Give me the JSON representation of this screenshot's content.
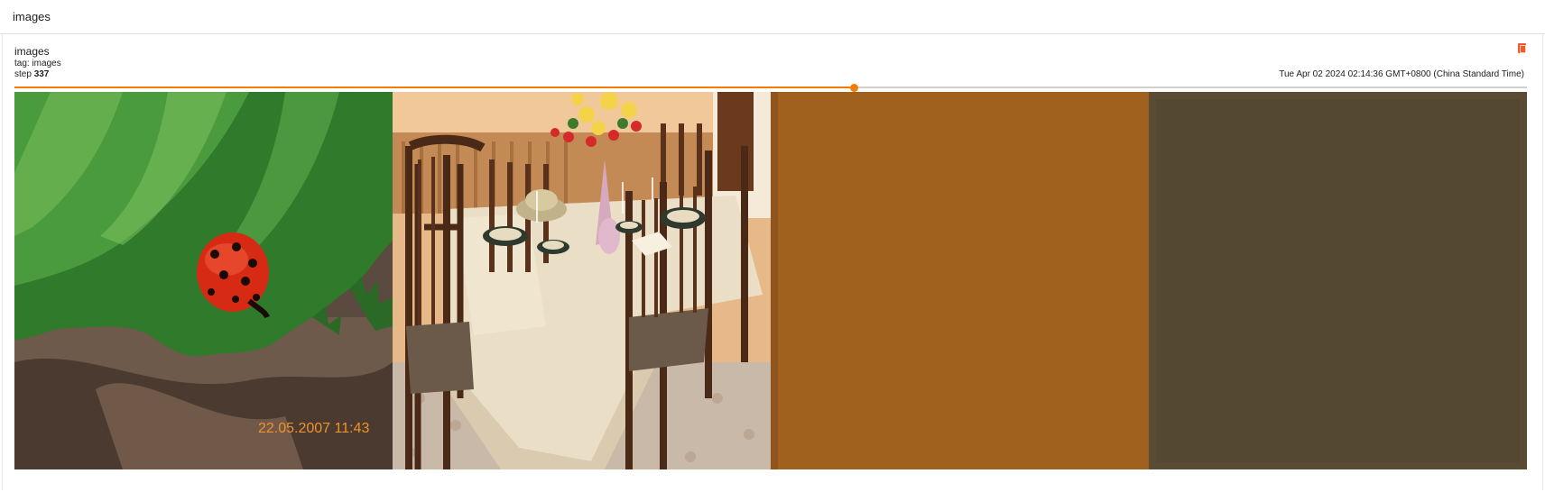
{
  "group": {
    "title": "images"
  },
  "card": {
    "title": "images",
    "tag": "tag: images",
    "step_label": "step",
    "step_value": "337",
    "timestamp": "Tue Apr 02 2024 02:14:36 GMT+0800 (China Standard Time)"
  },
  "slider": {
    "progress": 0.555,
    "accent": "#f57c00"
  },
  "images": [
    {
      "name": "ladybug-on-leaf",
      "date_stamp": "22.05.2007 11:43"
    },
    {
      "name": "dining-table-set"
    },
    {
      "name": "flat-orange-image",
      "color": "#a0611f"
    },
    {
      "name": "flat-olive-image",
      "color": "#5a4b35"
    }
  ]
}
